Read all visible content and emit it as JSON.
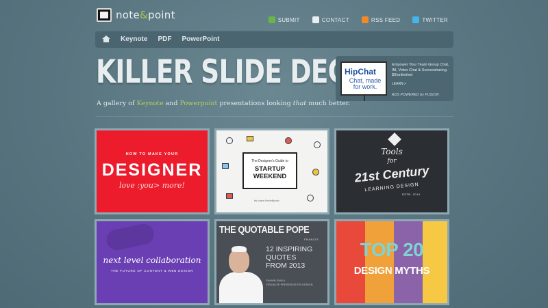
{
  "header": {
    "logo_text_a": "note",
    "logo_text_amp": "&",
    "logo_text_b": "point",
    "links": [
      {
        "label": "SUBMIT",
        "icon": "submit-icon"
      },
      {
        "label": "CONTACT",
        "icon": "envelope-icon"
      },
      {
        "label": "RSS FEED",
        "icon": "rss-icon"
      },
      {
        "label": "TWITTER",
        "icon": "twitter-icon"
      }
    ]
  },
  "nav": {
    "home_icon": "home-icon",
    "items": [
      "Keynote",
      "PDF",
      "PowerPoint"
    ]
  },
  "hero": {
    "title": "KILLER SLIDE DECKS.",
    "sub_a": "A gallery of ",
    "sub_keynote": "Keynote",
    "sub_b": " and ",
    "sub_powerpoint": "Powerpoint",
    "sub_c": " presentations looking ",
    "sub_that": "that",
    "sub_d": " much better."
  },
  "ad": {
    "brand": "HipChat",
    "tagline": "Chat, made for work.",
    "copy": "Empower Your Team Group Chat, IM, Video Chat & Screensharing. $0/unlimited",
    "learn": "LEARN >",
    "powered": "ADS POWERED by FUSION"
  },
  "gallery": {
    "c1": {
      "kicker": "HOW TO MAKE YOUR",
      "title": "DESIGNER",
      "tagline": "love :you> more!"
    },
    "c2": {
      "kicker": "The Designer's Guide to",
      "title_a": "STARTUP",
      "title_b": "WEEKEND",
      "byline": "by Ivana Nedeljkovic"
    },
    "c3": {
      "t1": "Tools",
      "t2": "for",
      "t3": "21st Century",
      "t4": "LEARNING DESIGN",
      "est": "ESTB. 2014"
    },
    "c4": {
      "title": "next level collaboration",
      "subtitle": "THE FUTURE OF CONTENT & WEB DESIGN"
    },
    "c5": {
      "title": "THE QUOTABLE POPE",
      "francis": "FRANCIS",
      "quote_a": "12 INSPIRING",
      "quote_b": "QUOTES",
      "quote_c": "FROM 2013",
      "credit_a": "SHAWN SMALL",
      "credit_b": "VISUALIZE PRESENTATION DESIGN"
    },
    "c6": {
      "title": "TOP 20",
      "subtitle": "DESIGN MYTHS",
      "stripe_colors": [
        "#e9493b",
        "#f0a13a",
        "#8b63a8",
        "#f7c844"
      ]
    }
  }
}
